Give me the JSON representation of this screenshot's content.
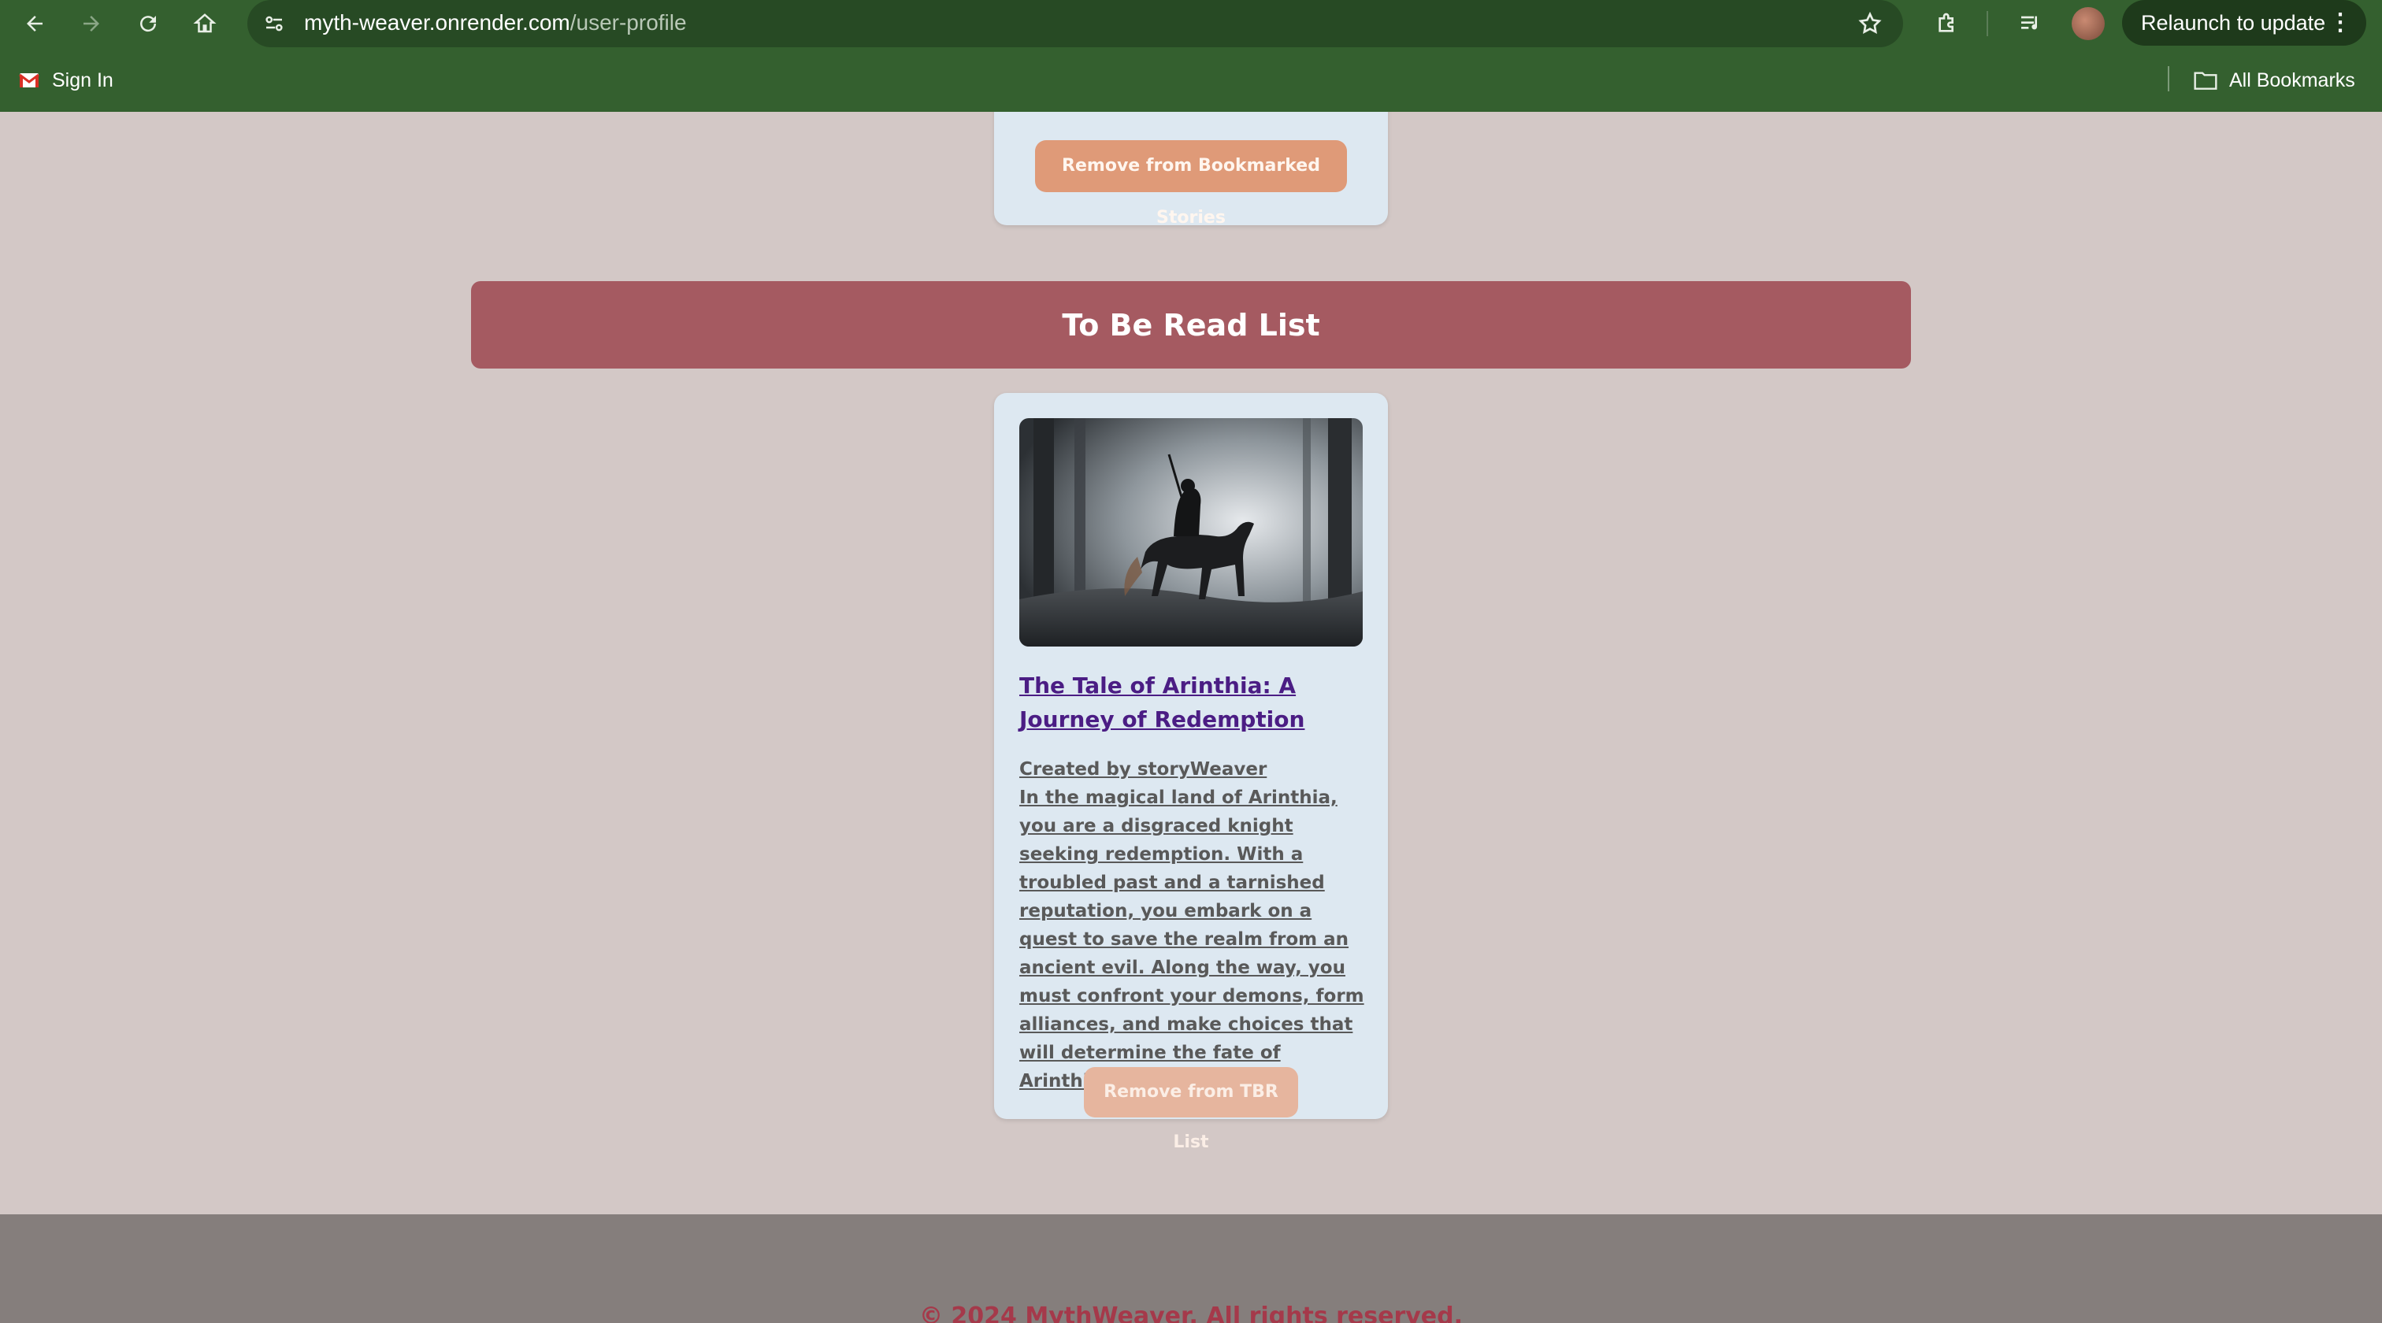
{
  "browser": {
    "url_host": "myth-weaver.onrender.com",
    "url_path": "/user-profile",
    "relaunch_label": "Relaunch to update",
    "bookmarks": [
      {
        "label": "Sign In",
        "icon": "gmail-icon"
      }
    ],
    "all_bookmarks_label": "All Bookmarks"
  },
  "bookmarked_section": {
    "remove_button_label": "Remove from Bookmarked Stories"
  },
  "tbr_section": {
    "heading": "To Be Read List",
    "stories": [
      {
        "title": "The Tale of Arinthia: A Journey of Redemption",
        "creator": "Created by storyWeaver",
        "description": "In the magical land of Arinthia, you are a disgraced knight seeking redemption. With a troubled past and a tarnished reputation, you embark on a quest to save the realm from an ancient evil. Along the way, you must confront your demons, form alliances, and make choices that will determine the fate of Arinthia.",
        "remove_button_label": "Remove from TBR List"
      }
    ]
  },
  "footer": {
    "copyright": "© 2024 MythWeaver. All rights reserved."
  },
  "colors": {
    "chrome_green": "#34602f",
    "page_bg": "#d3c8c6",
    "section_bar": "#a55a61",
    "card_bg": "#dde8f1",
    "button_peach": "#df9a78",
    "title_purple": "#4b1d84",
    "footer_text": "#a5394a"
  }
}
